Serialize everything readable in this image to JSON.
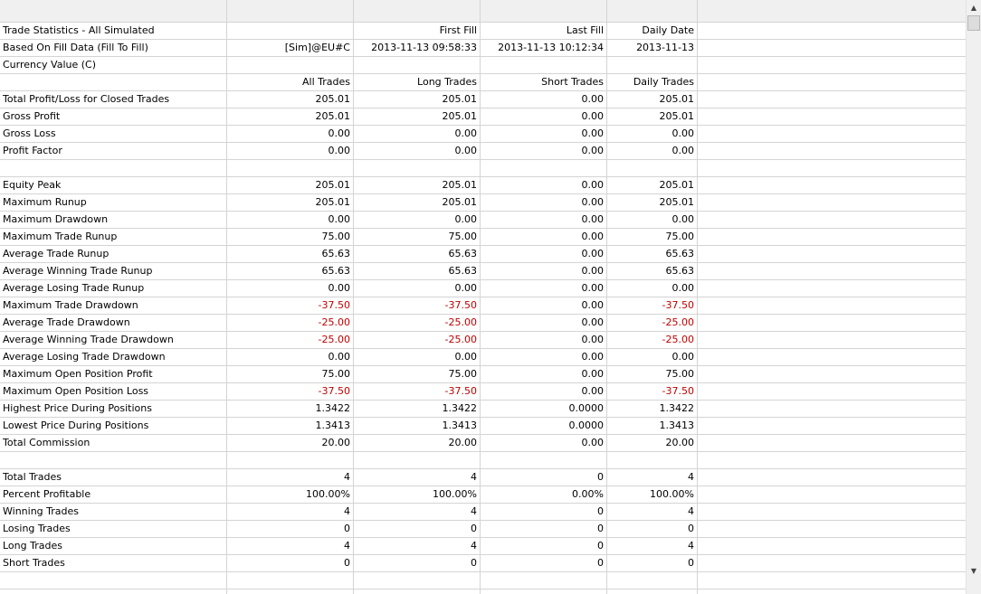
{
  "columns": [
    "",
    "",
    "",
    "",
    "",
    ""
  ],
  "rows": [
    {
      "label": "Trade Statistics - All Simulated",
      "v": [
        "",
        "First Fill",
        "Last Fill",
        "Daily Date"
      ],
      "neg": [
        false,
        false,
        false,
        false
      ]
    },
    {
      "label": "Based On Fill Data (Fill To Fill)",
      "v": [
        "[Sim]@EU#C",
        "2013-11-13  09:58:33",
        "2013-11-13  10:12:34",
        "2013-11-13"
      ],
      "neg": [
        false,
        false,
        false,
        false
      ]
    },
    {
      "label": "Currency Value (C)",
      "v": [
        "",
        "",
        "",
        ""
      ],
      "neg": [
        false,
        false,
        false,
        false
      ]
    },
    {
      "label": "",
      "v": [
        "All Trades",
        "Long Trades",
        "Short Trades",
        "Daily Trades"
      ],
      "neg": [
        false,
        false,
        false,
        false
      ]
    },
    {
      "label": "Total Profit/Loss for Closed Trades",
      "v": [
        "205.01",
        "205.01",
        "0.00",
        "205.01"
      ],
      "neg": [
        false,
        false,
        false,
        false
      ]
    },
    {
      "label": "Gross Profit",
      "v": [
        "205.01",
        "205.01",
        "0.00",
        "205.01"
      ],
      "neg": [
        false,
        false,
        false,
        false
      ]
    },
    {
      "label": "Gross Loss",
      "v": [
        "0.00",
        "0.00",
        "0.00",
        "0.00"
      ],
      "neg": [
        false,
        false,
        false,
        false
      ]
    },
    {
      "label": "Profit Factor",
      "v": [
        "0.00",
        "0.00",
        "0.00",
        "0.00"
      ],
      "neg": [
        false,
        false,
        false,
        false
      ]
    },
    {
      "label": "",
      "v": [
        "",
        "",
        "",
        ""
      ],
      "neg": [
        false,
        false,
        false,
        false
      ]
    },
    {
      "label": "Equity Peak",
      "v": [
        "205.01",
        "205.01",
        "0.00",
        "205.01"
      ],
      "neg": [
        false,
        false,
        false,
        false
      ]
    },
    {
      "label": "Maximum Runup",
      "v": [
        "205.01",
        "205.01",
        "0.00",
        "205.01"
      ],
      "neg": [
        false,
        false,
        false,
        false
      ]
    },
    {
      "label": "Maximum Drawdown",
      "v": [
        "0.00",
        "0.00",
        "0.00",
        "0.00"
      ],
      "neg": [
        false,
        false,
        false,
        false
      ]
    },
    {
      "label": "Maximum Trade Runup",
      "v": [
        "75.00",
        "75.00",
        "0.00",
        "75.00"
      ],
      "neg": [
        false,
        false,
        false,
        false
      ]
    },
    {
      "label": "Average Trade Runup",
      "v": [
        "65.63",
        "65.63",
        "0.00",
        "65.63"
      ],
      "neg": [
        false,
        false,
        false,
        false
      ]
    },
    {
      "label": "Average Winning Trade Runup",
      "v": [
        "65.63",
        "65.63",
        "0.00",
        "65.63"
      ],
      "neg": [
        false,
        false,
        false,
        false
      ]
    },
    {
      "label": "Average Losing Trade Runup",
      "v": [
        "0.00",
        "0.00",
        "0.00",
        "0.00"
      ],
      "neg": [
        false,
        false,
        false,
        false
      ]
    },
    {
      "label": "Maximum Trade Drawdown",
      "v": [
        "-37.50",
        "-37.50",
        "0.00",
        "-37.50"
      ],
      "neg": [
        true,
        true,
        false,
        true
      ]
    },
    {
      "label": "Average Trade Drawdown",
      "v": [
        "-25.00",
        "-25.00",
        "0.00",
        "-25.00"
      ],
      "neg": [
        true,
        true,
        false,
        true
      ]
    },
    {
      "label": "Average Winning Trade Drawdown",
      "v": [
        "-25.00",
        "-25.00",
        "0.00",
        "-25.00"
      ],
      "neg": [
        true,
        true,
        false,
        true
      ]
    },
    {
      "label": "Average Losing Trade Drawdown",
      "v": [
        "0.00",
        "0.00",
        "0.00",
        "0.00"
      ],
      "neg": [
        false,
        false,
        false,
        false
      ]
    },
    {
      "label": "Maximum Open Position Profit",
      "v": [
        "75.00",
        "75.00",
        "0.00",
        "75.00"
      ],
      "neg": [
        false,
        false,
        false,
        false
      ]
    },
    {
      "label": "Maximum Open Position Loss",
      "v": [
        "-37.50",
        "-37.50",
        "0.00",
        "-37.50"
      ],
      "neg": [
        true,
        true,
        false,
        true
      ]
    },
    {
      "label": "Highest Price During Positions",
      "v": [
        "1.3422",
        "1.3422",
        "0.0000",
        "1.3422"
      ],
      "neg": [
        false,
        false,
        false,
        false
      ]
    },
    {
      "label": "Lowest Price During Positions",
      "v": [
        "1.3413",
        "1.3413",
        "0.0000",
        "1.3413"
      ],
      "neg": [
        false,
        false,
        false,
        false
      ]
    },
    {
      "label": "Total Commission",
      "v": [
        "20.00",
        "20.00",
        "0.00",
        "20.00"
      ],
      "neg": [
        false,
        false,
        false,
        false
      ]
    },
    {
      "label": "",
      "v": [
        "",
        "",
        "",
        ""
      ],
      "neg": [
        false,
        false,
        false,
        false
      ]
    },
    {
      "label": "Total Trades",
      "v": [
        "4",
        "4",
        "0",
        "4"
      ],
      "neg": [
        false,
        false,
        false,
        false
      ]
    },
    {
      "label": "Percent Profitable",
      "v": [
        "100.00%",
        "100.00%",
        "0.00%",
        "100.00%"
      ],
      "neg": [
        false,
        false,
        false,
        false
      ]
    },
    {
      "label": "Winning Trades",
      "v": [
        "4",
        "4",
        "0",
        "4"
      ],
      "neg": [
        false,
        false,
        false,
        false
      ]
    },
    {
      "label": "Losing Trades",
      "v": [
        "0",
        "0",
        "0",
        "0"
      ],
      "neg": [
        false,
        false,
        false,
        false
      ]
    },
    {
      "label": "Long Trades",
      "v": [
        "4",
        "4",
        "0",
        "4"
      ],
      "neg": [
        false,
        false,
        false,
        false
      ]
    },
    {
      "label": "Short Trades",
      "v": [
        "0",
        "0",
        "0",
        "0"
      ],
      "neg": [
        false,
        false,
        false,
        false
      ]
    },
    {
      "label": "",
      "v": [
        "",
        "",
        "",
        ""
      ],
      "neg": [
        false,
        false,
        false,
        false
      ]
    }
  ],
  "colors": {
    "negative": "#c00000",
    "grid": "#d4d4d4",
    "header": "#f0f0f0"
  },
  "scrollbar": {
    "up_icon": "arrow-up-icon",
    "down_icon": "arrow-down-icon"
  }
}
